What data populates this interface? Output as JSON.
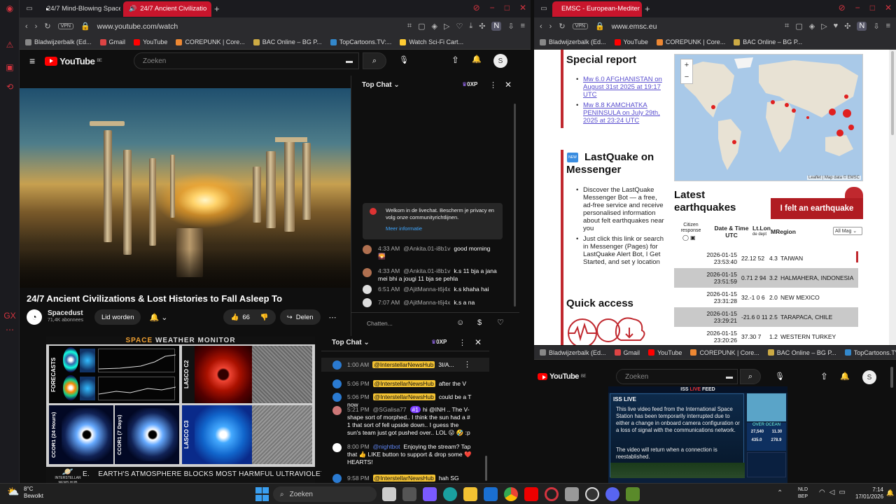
{
  "left_browser": {
    "tabs": [
      {
        "label": "24/7 Mind-Blowing Space",
        "active": false
      },
      {
        "label": "24/7 Ancient Civilizatio",
        "active": true
      }
    ],
    "vpn": "VPN",
    "url": "www.youtube.com/watch",
    "bookmarks": [
      "Bladwijzerbalk (Ed...",
      "Gmail",
      "YouTube",
      "COREPUNK | Core...",
      "BAC Online – BG P...",
      "TopCartoons.TV:...",
      "Watch Sci-Fi Cart..."
    ]
  },
  "youtube": {
    "logo": "YouTube",
    "region": "BE",
    "search_placeholder": "Zoeken",
    "avatar_letter": "S",
    "video_title": "24/7 Ancient Civilizations & Lost Histories to Fall Asleep To",
    "channel_name": "Spacedust",
    "subscribers": "71,4K abonnees",
    "join_label": "Lid worden",
    "likes": "66",
    "share_label": "Delen"
  },
  "chat_main": {
    "title": "Top Chat",
    "points": "0XP",
    "welcome": "Welkom in de livechat. Bescherm je privacy en volg onze communityrichtlijnen.",
    "more_info": "Meer informatie",
    "input_placeholder": "Chatten...",
    "messages": [
      {
        "time": "4:33 AM",
        "user": "@Ankita.01-i8b1v",
        "text": "good morning 🌄"
      },
      {
        "time": "4:33 AM",
        "user": "@Ankita.01-i8b1v",
        "text": "k.s 11 bja a jana mei bhi a jougi 11 bja se pehla"
      },
      {
        "time": "6:51 AM",
        "user": "@AjitManna-t6j4x",
        "text": "k.s khaha hai"
      },
      {
        "time": "7:07 AM",
        "user": "@AjitManna-t6j4x",
        "text": "k.s a na"
      }
    ]
  },
  "right_browser": {
    "tab_label": "EMSC - European-Mediter",
    "vpn": "VPN",
    "url": "www.emsc.eu",
    "bookmarks": [
      "Bladwijzerbalk (Ed...",
      "YouTube",
      "COREPUNK | Core...",
      "BAC Online – BG P..."
    ]
  },
  "emsc": {
    "special_report_title": "Special report",
    "reports": [
      "Mw 6.0 AFGHANISTAN on August 31st 2025 at 19:17 UTC",
      "Mw 8.8 KAMCHATKA PENINSULA on July 29th, 2025 at 23:24 UTC"
    ],
    "new_badge": "NEW",
    "lastquake_title": "LastQuake on Messenger",
    "lastquake_items": [
      "Discover the LastQuake Messenger Bot — a free, ad-free service and receive personalised information about felt earthquakes near you",
      "Just click this link or search in Messenger (Pages) for LastQuake Alert Bot, I Get Started, and set y location"
    ],
    "latest_title": "Latest earthquakes",
    "felt_button": "I felt an earthquake",
    "col_citizen": "Citizen response",
    "col_datetime": "Date & Time UTC",
    "col_latlon": "Lt.Lon",
    "col_depth": "de dept",
    "col_mag": "M",
    "col_region": "Region",
    "mag_filter": "All Mag",
    "quick_access_title": "Quick access",
    "map_attribution": "Leaflet | Map data © EMSC",
    "quakes": [
      {
        "date": "2026-01-15",
        "time": "23:53:40",
        "lat": "22.12",
        "lon": "52",
        "mag": "4.3",
        "region": "TAIWAN"
      },
      {
        "date": "2026-01-15",
        "time": "23:51:59",
        "lat": "0.71",
        "lon": "2 94",
        "mag": "3.2",
        "region": "HALMAHERA, INDONESIA"
      },
      {
        "date": "2026-01-15",
        "time": "23:31:28",
        "lat": "32.-1",
        "lon": "0 6",
        "mag": "2.0",
        "region": "NEW MEXICO"
      },
      {
        "date": "2026-01-15",
        "time": "23:29:21",
        "lat": "-21.6",
        "lon": "0 11",
        "mag": "2.5",
        "region": "TARAPACA, CHILE"
      },
      {
        "date": "2026-01-15",
        "time": "23:20:26",
        "lat": "37.30",
        "lon": "7",
        "mag": "1.2",
        "region": "WESTERN TURKEY"
      }
    ]
  },
  "space_weather": {
    "title_a": "SPACE",
    "title_b": "WEATHER MONITOR",
    "labels": [
      "FORECASTS",
      "LASCO C2",
      "CCOR1 (24 Hours)",
      "CCOR1 (7 Days)",
      "LASCO C3"
    ],
    "ticker": "EARTH'S ATMOSPHERE BLOCKS MOST HARMFUL ULTRAVIOLET R",
    "ticker_prefix": "E.",
    "logo_text": "INTERSTELLAR NEWS HUB"
  },
  "chat_bottom": {
    "title": "Top Chat",
    "points": "0XP",
    "messages": [
      {
        "time": "1:00 AM",
        "user": "@InterstellarNewsHub",
        "text": "3I/A..."
      },
      {
        "time": "5:06 PM",
        "user": "@InterstellarNewsHub",
        "text": "after the V"
      },
      {
        "time": "5:06 PM",
        "user": "@InterstellarNewsHub",
        "text": "could be a T now"
      },
      {
        "time": "5:21 PM",
        "user": "@SGalisa77",
        "badge": "#1",
        "text": "hi @INH .. The V-shape sort of morphed.. I think the sun had a # 1 that sort of fell upside down.. I guess the sun's team just got pushed over.. LOL 😛 🤣 :p"
      },
      {
        "time": "8:00 PM",
        "user": "@nightbot",
        "text": "Enjoying the stream? Tap that 👍 LIKE button to support & drop some ❤️ HEARTS!"
      },
      {
        "time": "9:58 PM",
        "user": "@InterstellarNewsHub",
        "text": "hah SG"
      }
    ]
  },
  "bottom_right": {
    "bookmarks": [
      "Bladwijzerbalk (Ed...",
      "Gmail",
      "YouTube",
      "COREPUNK | Core...",
      "BAC Online – BG P...",
      "TopCartoons.TV:..."
    ],
    "search_placeholder": "Zoeken",
    "logo": "YouTube",
    "region": "BE",
    "avatar_letter": "S",
    "iss_header_a": "ISS",
    "iss_header_b": "LIVE",
    "iss_header_c": "FEED",
    "iss_badge": "ISS LIVE",
    "iss_message_1": "This live video feed from the International Space Station has been temporarily interrupted due to either a change in onboard camera configuration or a loss of signal with the communications network.",
    "iss_message_2": "The video will return when a connection is reestablished.",
    "iss_side_label": "OVER OCEAN",
    "iss_stats": [
      "27,540",
      "11.30",
      "435.0",
      "278.9"
    ]
  },
  "taskbar": {
    "temp": "8°C",
    "weather": "Bewolkt",
    "search": "Zoeken",
    "lang1": "NLD",
    "lang2": "BEP",
    "time": "7:14",
    "date": "17/01/2026"
  },
  "colors": {
    "youtube_red": "#ff0000",
    "browser_red": "#c8152c",
    "emsc_red": "#c0282e",
    "emsc_link": "#5a4fcf",
    "chat_highlight": "#f3c232"
  }
}
